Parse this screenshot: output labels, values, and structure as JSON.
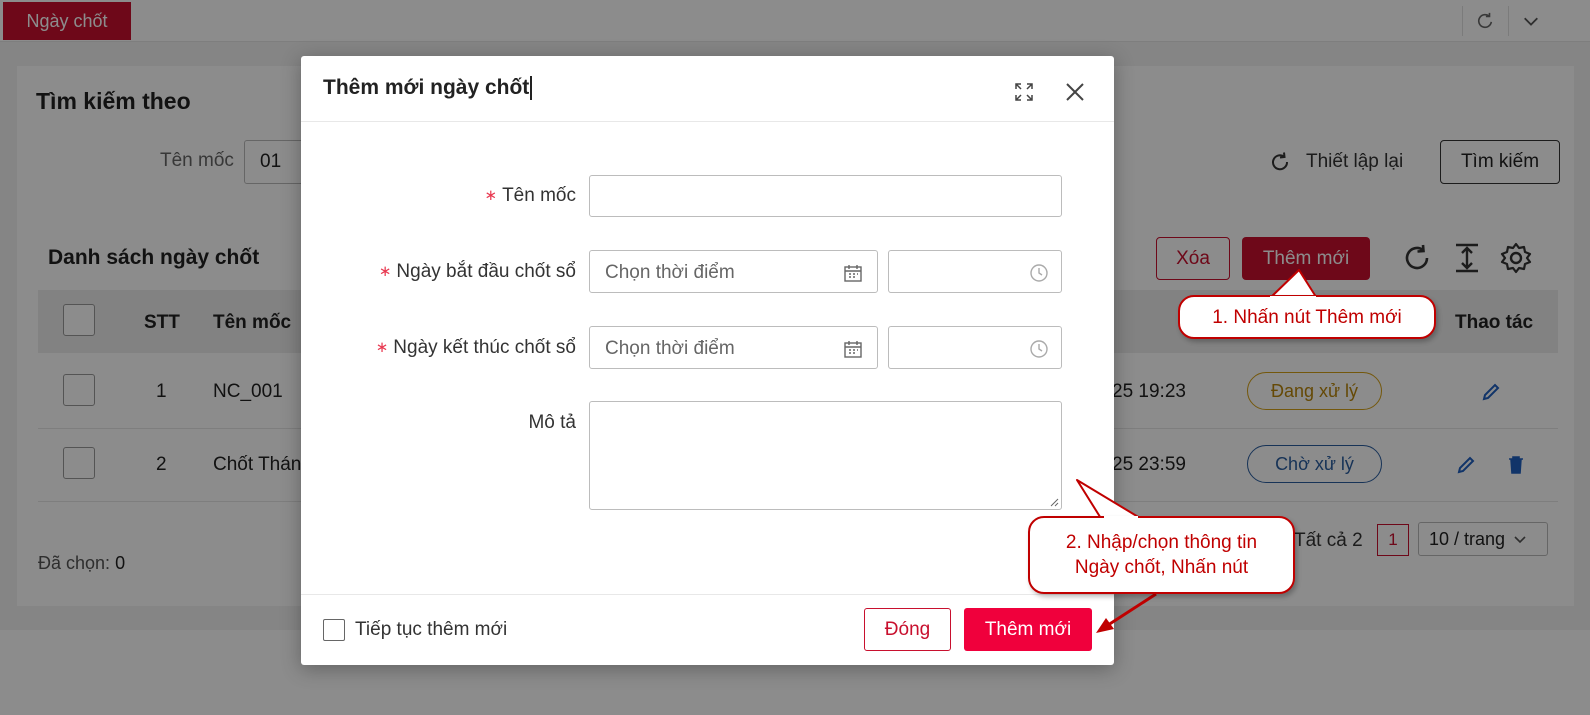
{
  "topbar": {
    "active_tab": "Ngày chốt"
  },
  "search": {
    "title": "Tìm kiếm theo",
    "name_label": "Tên mốc",
    "name_value": "01",
    "reset_label": "Thiết lập lại",
    "search_label": "Tìm kiếm"
  },
  "list": {
    "title": "Danh sách ngày chốt",
    "delete_label": "Xóa",
    "add_label": "Thêm mới",
    "columns": {
      "stt": "STT",
      "name": "Tên mốc",
      "actions": "Thao tác"
    },
    "rows": [
      {
        "stt": "1",
        "name": "NC_001",
        "time": "25 19:23",
        "status": "Đang xử lý"
      },
      {
        "stt": "2",
        "name": "Chốt Thán",
        "time": "25 23:59",
        "status": "Chờ xử lý"
      }
    ],
    "selected_label": "Đã chọn:",
    "selected_count": "0",
    "total_label": "Tất cả 2",
    "current_page": "1",
    "page_size": "10 / trang"
  },
  "modal": {
    "title": "Thêm mới ngày chốt",
    "fields": {
      "name_label": "Tên mốc",
      "start_label": "Ngày bắt đầu chốt sổ",
      "end_label": "Ngày kết thúc chốt sổ",
      "desc_label": "Mô tả",
      "date_placeholder": "Chọn thời điểm"
    },
    "continue_label": "Tiếp tục thêm mới",
    "close_label": "Đóng",
    "submit_label": "Thêm mới"
  },
  "callouts": {
    "step1": "1. Nhấn nút Thêm mới",
    "step2_line1": "2. Nhập/chọn thông tin",
    "step2_line2": "Ngày chốt, Nhấn nút"
  },
  "colors": {
    "brand_red": "#c8102e",
    "submit_red": "#f0003c",
    "status_processing": "#d4a017",
    "status_waiting": "#2a5d9f",
    "callout_red": "#c00000"
  }
}
